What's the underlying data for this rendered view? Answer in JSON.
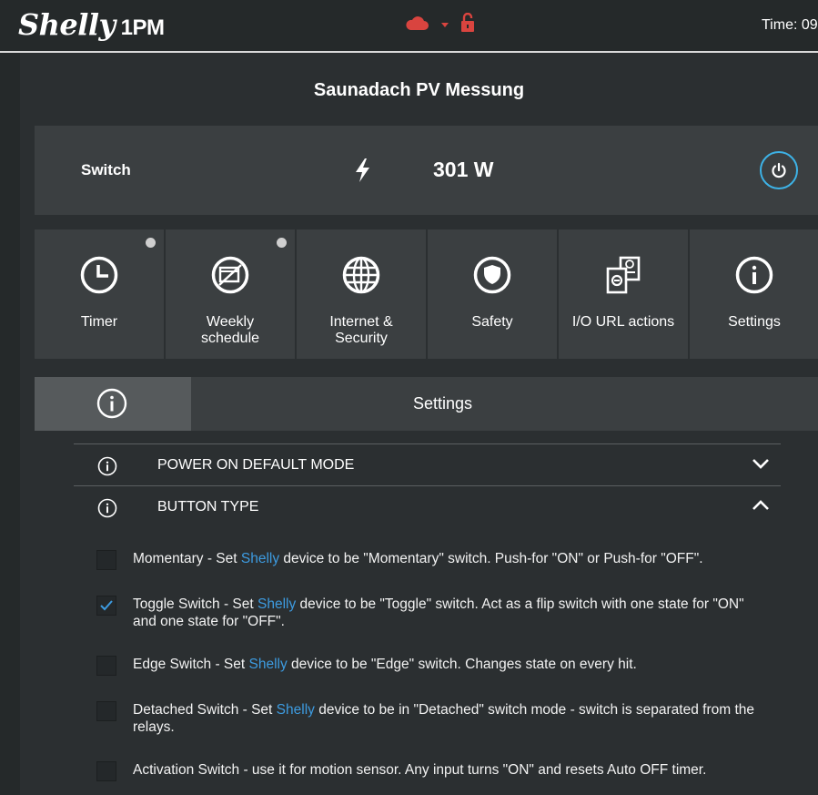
{
  "header": {
    "brand": "Shelly",
    "model": "1PM",
    "time_label": "Time: 09",
    "colors": {
      "status_icons": "#d9443f",
      "accent": "#3db2e6",
      "link": "#3d9be0"
    },
    "icons": [
      "cloud-icon",
      "signal-icon",
      "unlock-icon"
    ]
  },
  "device": {
    "name": "Saunadach PV Messung"
  },
  "switch": {
    "label": "Switch",
    "power": "301 W",
    "icon": "bolt-icon",
    "button_icon": "power-icon"
  },
  "tiles": [
    {
      "name": "timer",
      "line1": "Timer",
      "line2": "",
      "icon": "clock-icon",
      "dot": true
    },
    {
      "name": "weekly-schedule",
      "line1": "Weekly",
      "line2": "schedule",
      "icon": "calendar-icon",
      "dot": true
    },
    {
      "name": "internet-security",
      "line1": "Internet &",
      "line2": "Security",
      "icon": "globe-icon",
      "dot": false
    },
    {
      "name": "safety",
      "line1": "Safety",
      "line2": "",
      "icon": "shield-icon",
      "dot": false
    },
    {
      "name": "io-url-actions",
      "line1": "I/O URL actions",
      "line2": "",
      "icon": "url-actions-icon",
      "dot": false
    },
    {
      "name": "settings",
      "line1": "Settings",
      "line2": "",
      "icon": "info-icon",
      "dot": false
    }
  ],
  "settings_panel": {
    "title": "Settings"
  },
  "accordion": [
    {
      "title": "POWER ON DEFAULT MODE",
      "expanded": false
    },
    {
      "title": "BUTTON TYPE",
      "expanded": true
    }
  ],
  "button_type_options": [
    {
      "checked": false,
      "pre": "Momentary - Set ",
      "brand": "Shelly",
      "post": " device to be \"Momentary\" switch. Push-for \"ON\" or Push-for \"OFF\"."
    },
    {
      "checked": true,
      "pre": "Toggle Switch - Set ",
      "brand": "Shelly",
      "post": " device to be \"Toggle\" switch. Act as a flip switch with one state for \"ON\" and one state for \"OFF\"."
    },
    {
      "checked": false,
      "pre": "Edge Switch - Set ",
      "brand": "Shelly",
      "post": " device to be \"Edge\" switch. Changes state on every hit."
    },
    {
      "checked": false,
      "pre": "Detached Switch - Set ",
      "brand": "Shelly",
      "post": " device to be in \"Detached\" switch mode - switch is separated from the relays."
    },
    {
      "checked": false,
      "pre": "Activation Switch - use it for motion sensor. Any input turns \"ON\" and resets Auto OFF timer.",
      "brand": "",
      "post": ""
    }
  ]
}
